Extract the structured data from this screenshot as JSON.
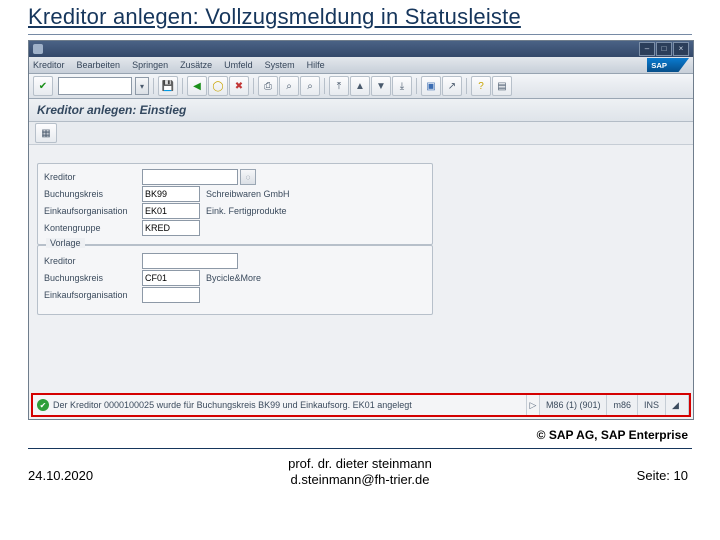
{
  "slide": {
    "title": "Kreditor anlegen: Vollzugsmeldung in Statusleiste",
    "copyright": "© SAP AG, SAP Enterprise",
    "date": "24.10.2020",
    "author_line1": "prof. dr. dieter steinmann",
    "author_line2": "d.steinmann@fh-trier.de",
    "page": "Seite: 10"
  },
  "sap": {
    "menus": [
      "Kreditor",
      "Bearbeiten",
      "Springen",
      "Zusätze",
      "Umfeld",
      "System",
      "Hilfe"
    ],
    "screen_title": "Kreditor anlegen: Einstieg",
    "group1": {
      "rows": [
        {
          "label": "Kreditor",
          "value": "",
          "desc": "",
          "has_help": true
        },
        {
          "label": "Buchungskreis",
          "value": "BK99",
          "desc": "Schreibwaren GmbH",
          "has_help": false
        },
        {
          "label": "Einkaufsorganisation",
          "value": "EK01",
          "desc": "Eink. Fertigprodukte",
          "has_help": false
        },
        {
          "label": "Kontengruppe",
          "value": "KRED",
          "desc": "",
          "has_help": false
        }
      ]
    },
    "group2": {
      "title": "Vorlage",
      "rows": [
        {
          "label": "Kreditor",
          "value": "",
          "desc": ""
        },
        {
          "label": "Buchungskreis",
          "value": "CF01",
          "desc": "Bycicle&More"
        },
        {
          "label": "Einkaufsorganisation",
          "value": "",
          "desc": ""
        }
      ]
    },
    "status": {
      "message": "Der Kreditor 0000100025 wurde für Buchungskreis BK99 und Einkaufsorg. EK01 angelegt",
      "cells": [
        "M86 (1) (901)",
        "m86",
        "INS"
      ],
      "icon": "success-icon"
    },
    "toolbar_icons": [
      "check-icon",
      "save-icon",
      "back-icon",
      "exit-icon",
      "cancel-icon",
      "print-icon",
      "find-icon",
      "find-next-icon",
      "first-page-icon",
      "prev-page-icon",
      "next-page-icon",
      "last-page-icon",
      "new-session-icon",
      "shortcut-icon",
      "help-icon",
      "layout-icon"
    ],
    "sub_toolbar_icon": "info-icon",
    "win_buttons": [
      "minimize-icon",
      "maximize-icon",
      "close-icon"
    ],
    "logo_text": "SAP"
  }
}
